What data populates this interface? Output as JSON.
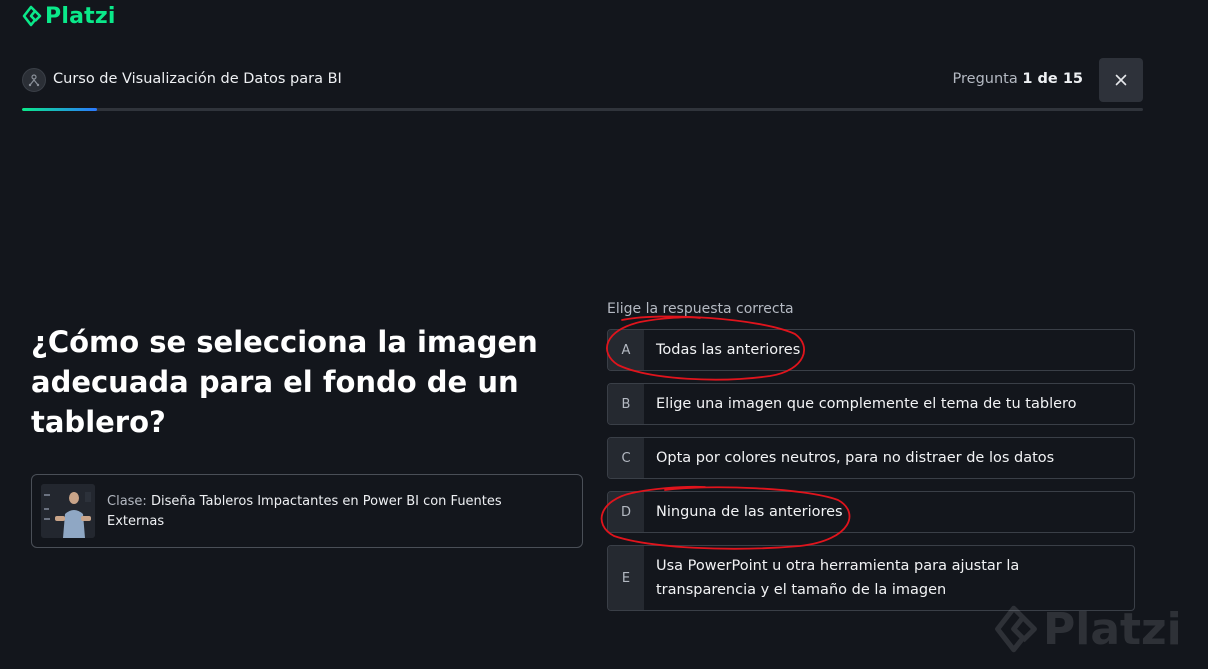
{
  "brand": {
    "name": "Platzi",
    "color": "#0ae98a"
  },
  "course": {
    "title": "Curso de Visualización de Datos para BI",
    "icon": "course-badge-icon"
  },
  "counter": {
    "label": "Pregunta",
    "current": "1",
    "separator": "de",
    "total": "15"
  },
  "close": {
    "icon": "close-icon",
    "label": "×"
  },
  "progress": {
    "value": 0.067
  },
  "question": {
    "text": "¿Cómo se selecciona la imagen adecuada para el fondo de un tablero?"
  },
  "class_link": {
    "prefix": "Clase:",
    "title": "Diseña Tableros Impactantes en Power BI con Fuentes Externas"
  },
  "answers": {
    "label": "Elige la respuesta correcta",
    "options": [
      {
        "letter": "A",
        "text": "Todas las anteriores"
      },
      {
        "letter": "B",
        "text": "Elige una imagen que complemente el tema de tu tablero"
      },
      {
        "letter": "C",
        "text": "Opta por colores neutros, para no distraer de los datos"
      },
      {
        "letter": "D",
        "text": "Ninguna de las anteriores"
      },
      {
        "letter": "E",
        "text": "Usa PowerPoint u otra herramienta para ajustar la transparencia y el tamaño de la imagen"
      }
    ]
  },
  "annotation": {
    "color": "#e0141c"
  },
  "watermark": {
    "text": "Platzi"
  }
}
